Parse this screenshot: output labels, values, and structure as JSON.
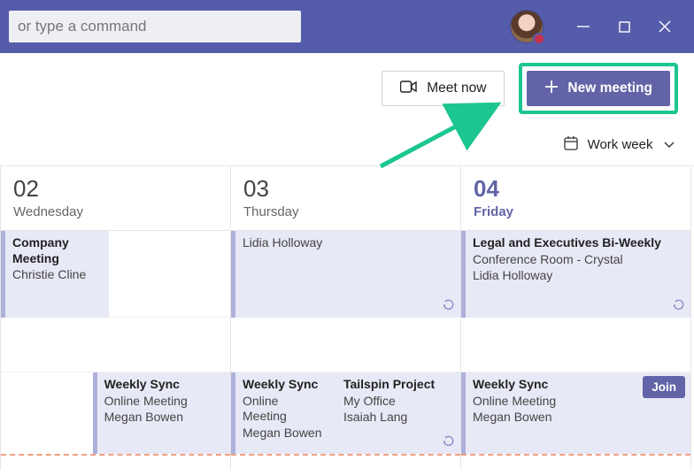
{
  "search": {
    "placeholder": "or type a command"
  },
  "toolbar": {
    "meet_now": "Meet now",
    "new_meeting": "New meeting"
  },
  "viewbar": {
    "mode": "Work week"
  },
  "days": [
    {
      "num": "02",
      "name": "Wednesday",
      "today": false
    },
    {
      "num": "03",
      "name": "Thursday",
      "today": false
    },
    {
      "num": "04",
      "name": "Friday",
      "today": true
    }
  ],
  "events": {
    "wed_top": {
      "title": "Company Meeting",
      "location": "",
      "organizer": "Christie Cline",
      "recurring": false
    },
    "thu_top": {
      "title": "",
      "location": "",
      "organizer": "Lidia Holloway",
      "recurring": true
    },
    "fri_top": {
      "title": "Legal and Executives Bi-Weekly",
      "location": "Conference Room - Crystal",
      "organizer": "Lidia Holloway",
      "recurring": true
    },
    "weekly_sync_wed": {
      "title": "Weekly Sync",
      "location": "Online Meeting",
      "organizer": "Megan Bowen",
      "recurring": true
    },
    "weekly_sync_thu": {
      "title": "Weekly Sync",
      "location": "Online Meeting",
      "organizer": "Megan Bowen",
      "recurring": false
    },
    "tailspin": {
      "title": "Tailspin Project",
      "location": "My Office",
      "organizer": "Isaiah Lang",
      "recurring": true
    },
    "weekly_sync_fri": {
      "title": "Weekly Sync",
      "location": "Online Meeting",
      "organizer": "Megan Bowen",
      "recurring": false,
      "join": "Join"
    }
  }
}
